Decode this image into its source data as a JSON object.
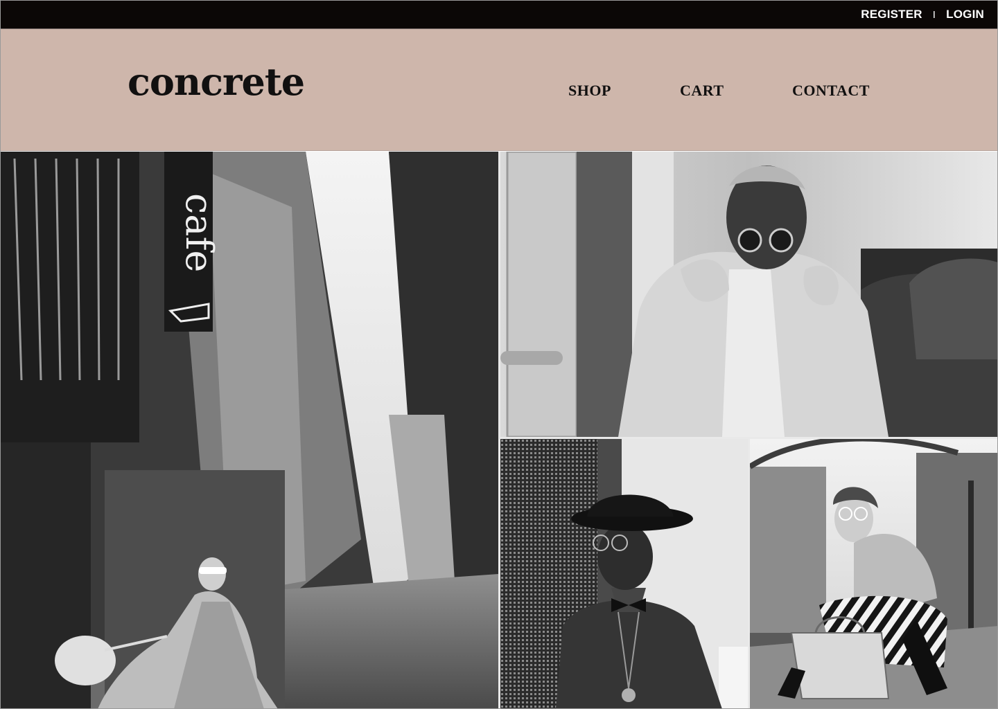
{
  "topbar": {
    "register_label": "REGISTER",
    "separator": "I",
    "login_label": "LOGIN"
  },
  "header": {
    "logo_text": "concrete",
    "nav": {
      "shop_label": "SHOP",
      "cart_label": "CART",
      "contact_label": "CONTACT"
    }
  },
  "colors": {
    "topbar_bg": "#0b0706",
    "header_bg": "#ceb6ab",
    "text_dark": "#111010"
  },
  "photos": {
    "cafe_sign_text": "cafe"
  }
}
